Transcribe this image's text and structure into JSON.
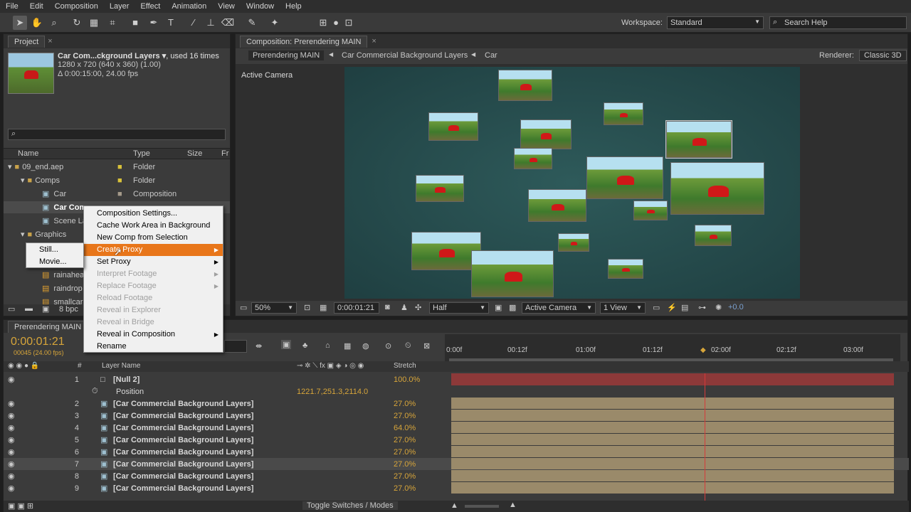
{
  "menu": [
    "File",
    "Edit",
    "Composition",
    "Layer",
    "Effect",
    "Animation",
    "View",
    "Window",
    "Help"
  ],
  "workspace": {
    "label": "Workspace:",
    "value": "Standard"
  },
  "search_help": {
    "placeholder": "Search Help"
  },
  "project": {
    "tab": "Project",
    "item_name": "Car Com...ckground Layers ▾",
    "used": ", used 16 times",
    "dims": "1280 x 720  (640 x 360) (1.00)",
    "duration": "Δ 0:00:15:00, 24.00 fps",
    "columns": {
      "name": "Name",
      "type": "Type",
      "size": "Size",
      "fr": "Fr"
    },
    "tree": [
      {
        "name": "09_end.aep",
        "type": "Folder"
      },
      {
        "name": "Comps",
        "type": "Folder"
      },
      {
        "name": "Car",
        "type": "Composition"
      },
      {
        "name": "Car Com",
        "type": ""
      },
      {
        "name": "Scene La",
        "type": ""
      },
      {
        "name": "Graphics",
        "type": ""
      },
      {
        "name": "rainahea",
        "type": ""
      },
      {
        "name": "raindrop",
        "type": ""
      },
      {
        "name": "smallcar",
        "type": ""
      }
    ],
    "bpc": "8 bpc"
  },
  "context_menu": [
    {
      "label": "Composition Settings...",
      "disabled": false
    },
    {
      "label": "Cache Work Area in Background",
      "disabled": false
    },
    {
      "label": "New Comp from Selection",
      "disabled": false
    },
    {
      "label": "Create Proxy",
      "disabled": false,
      "submenu": true,
      "highlight": true
    },
    {
      "label": "Set Proxy",
      "disabled": false,
      "submenu": true
    },
    {
      "label": "Interpret Footage",
      "disabled": true,
      "submenu": true
    },
    {
      "label": "Replace Footage",
      "disabled": true,
      "submenu": true
    },
    {
      "label": "Reload Footage",
      "disabled": true
    },
    {
      "label": "Reveal in Explorer",
      "disabled": true
    },
    {
      "label": "Reveal in Bridge",
      "disabled": true
    },
    {
      "label": "Reveal in Composition",
      "disabled": false,
      "submenu": true
    },
    {
      "label": "Rename",
      "disabled": false
    }
  ],
  "submenu": [
    "Still...",
    "Movie..."
  ],
  "composition": {
    "tab": "Composition: Prerendering MAIN",
    "breadcrumbs": [
      "Prerendering MAIN",
      "Car Commercial Background Layers",
      "Car"
    ],
    "renderer_label": "Renderer:",
    "renderer": "Classic 3D",
    "active_camera": "Active Camera",
    "zoom": "50%",
    "timecode": "0:00:01:21",
    "resolution": "Half",
    "view": "Active Camera",
    "views": "1 View",
    "exposure": "+0.0"
  },
  "timeline": {
    "tab": "Prerendering MAIN",
    "timecode": "0:00:01:21",
    "frames": "00045 (24.00 fps)",
    "ruler": [
      "0:00f",
      "00:12f",
      "01:00f",
      "01:12f",
      "02:00f",
      "02:12f",
      "03:00f"
    ],
    "col_num": "#",
    "col_layer": "Layer Name",
    "col_stretch": "Stretch",
    "layers": [
      {
        "num": "1",
        "name": "[Null 2]",
        "stretch": "100.0%"
      },
      {
        "num": "",
        "name": "Position",
        "stretch": "1221.7,251.3,2114.0"
      },
      {
        "num": "2",
        "name": "[Car Commercial Background Layers]",
        "stretch": "27.0%"
      },
      {
        "num": "3",
        "name": "[Car Commercial Background Layers]",
        "stretch": "27.0%"
      },
      {
        "num": "4",
        "name": "[Car Commercial Background Layers]",
        "stretch": "64.0%"
      },
      {
        "num": "5",
        "name": "[Car Commercial Background Layers]",
        "stretch": "27.0%"
      },
      {
        "num": "6",
        "name": "[Car Commercial Background Layers]",
        "stretch": "27.0%"
      },
      {
        "num": "7",
        "name": "[Car Commercial Background Layers]",
        "stretch": "27.0%"
      },
      {
        "num": "8",
        "name": "[Car Commercial Background Layers]",
        "stretch": "27.0%"
      },
      {
        "num": "9",
        "name": "[Car Commercial Background Layers]",
        "stretch": "27.0%"
      }
    ],
    "toggle": "Toggle Switches / Modes"
  },
  "colors": {
    "accent": "#e8761a",
    "timecode": "#d7a53a",
    "playhead": "#d43a3a"
  }
}
